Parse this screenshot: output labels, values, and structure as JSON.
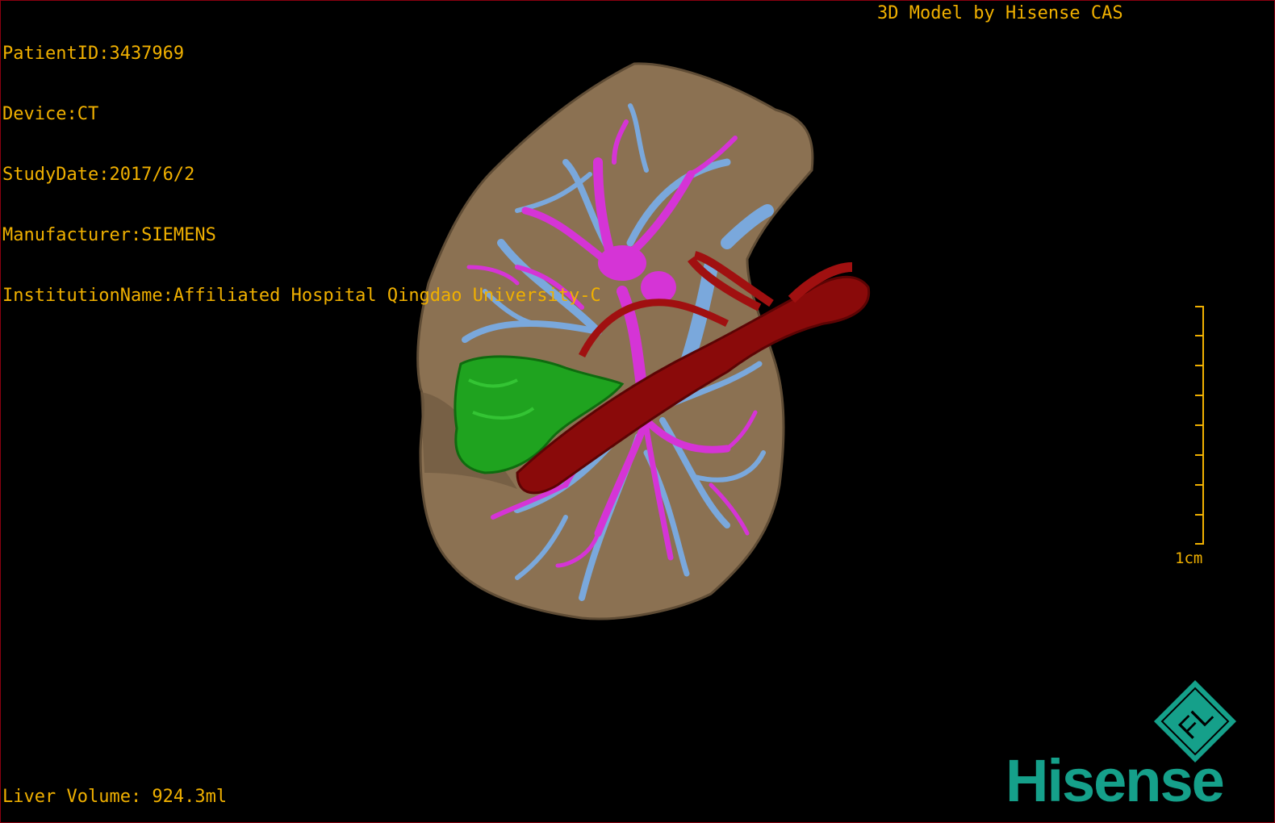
{
  "overlay": {
    "patient_id": "PatientID:3437969",
    "device": "Device:CT",
    "study_date": "StudyDate:2017/6/2",
    "manufacturer": "Manufacturer:SIEMENS",
    "institution": "InstitutionName:Affiliated Hospital Qingdao University-C",
    "credit": "3D Model by Hisense CAS",
    "liver_volume": "Liver Volume: 924.3ml"
  },
  "scale_bar": {
    "label": "1cm"
  },
  "logo": {
    "word": "Hisense",
    "mark_letters": "FL",
    "brand_color": "#15a08a"
  },
  "colors": {
    "text": "#f0b000",
    "liver": "#8b7152",
    "portal_vein": "#7aa8dc",
    "hepatic_vein": "#d534d6",
    "artery_vessel": "#8a0a0a",
    "lesion": "#1fa31f",
    "frame": "#8a0010"
  }
}
